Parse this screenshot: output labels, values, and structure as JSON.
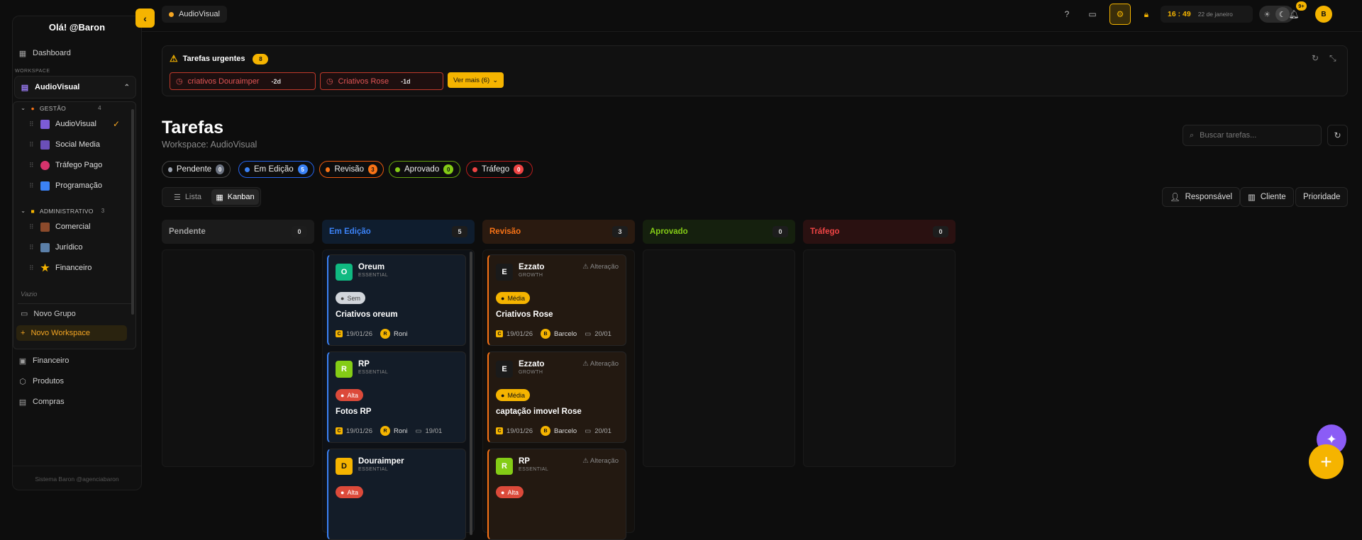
{
  "sidebar": {
    "greeting": "Olá! @Baron",
    "dashboard": "Dashboard",
    "workspace_label": "WORKSPACE",
    "workspace_current": "AudioVisual",
    "groups": [
      {
        "name": "GESTÃO",
        "count": "4",
        "items": [
          "AudioVisual",
          "Social Media",
          "Tráfego Pago",
          "Programação"
        ]
      },
      {
        "name": "ADMINISTRATIVO",
        "count": "3",
        "items": [
          "Comercial",
          "Jurídico",
          "Financeiro"
        ]
      }
    ],
    "empty": "Vazio",
    "new_group": "Novo Grupo",
    "new_workspace": "Novo Workspace",
    "bottom_links": [
      "Financeiro",
      "Produtos",
      "Compras"
    ],
    "footer": "Sistema Baron @agenciabaron"
  },
  "topbar": {
    "breadcrumb": "AudioVisual",
    "time": "16 : 49",
    "date": "22 de janeiro",
    "notif_badge": "9+",
    "avatar": "B"
  },
  "urgent": {
    "title": "Tarefas urgentes",
    "count": "8",
    "chips": [
      {
        "label": "criativos Douraimper",
        "delay": "-2d"
      },
      {
        "label": "Criativos Rose",
        "delay": "-1d"
      }
    ],
    "more": "Ver mais (6)"
  },
  "page": {
    "title": "Tarefas",
    "subtitle": "Workspace: AudioVisual",
    "search_placeholder": "Buscar tarefas..."
  },
  "statuses": [
    {
      "label": "Pendente",
      "count": "0",
      "color": "#9ca3af"
    },
    {
      "label": "Em Edição",
      "count": "5",
      "color": "#3b82f6"
    },
    {
      "label": "Revisão",
      "count": "3",
      "color": "#f97316"
    },
    {
      "label": "Aprovado",
      "count": "0",
      "color": "#84cc16"
    },
    {
      "label": "Tráfego",
      "count": "0",
      "color": "#ef4444"
    }
  ],
  "views": {
    "list": "Lista",
    "kanban": "Kanban"
  },
  "filters": {
    "responsible": "Responsável",
    "client": "Cliente",
    "priority": "Prioridade"
  },
  "columns": [
    {
      "label": "Pendente",
      "count": "0"
    },
    {
      "label": "Em Edição",
      "count": "5"
    },
    {
      "label": "Revisão",
      "count": "3"
    },
    {
      "label": "Aprovado",
      "count": "0"
    },
    {
      "label": "Tráfego",
      "count": "0"
    }
  ],
  "cards_edicao": [
    {
      "initial": "O",
      "client": "Oreum",
      "plan": "ESSENTIAL",
      "priority": "Sem",
      "title": "Criativos oreum",
      "created": "19/01/26",
      "user_initial": "R",
      "user": "Roni",
      "due": ""
    },
    {
      "initial": "R",
      "client": "RP",
      "plan": "ESSENTIAL",
      "priority": "Alta",
      "title": "Fotos RP",
      "created": "19/01/26",
      "user_initial": "R",
      "user": "Roni",
      "due": "19/01"
    },
    {
      "initial": "D",
      "client": "Douraimper",
      "plan": "ESSENTIAL",
      "priority": "Alta",
      "title": "",
      "created": "",
      "user_initial": "",
      "user": "",
      "due": ""
    }
  ],
  "cards_revisao": [
    {
      "initial": "E",
      "client": "Ezzato",
      "plan": "GROWTH",
      "tag": "Alteração",
      "priority": "Média",
      "title": "Criativos Rose",
      "created": "19/01/26",
      "user_initial": "B",
      "user": "Barcelo",
      "due": "20/01"
    },
    {
      "initial": "E",
      "client": "Ezzato",
      "plan": "GROWTH",
      "tag": "Alteração",
      "priority": "Média",
      "title": "captação imovel Rose",
      "created": "19/01/26",
      "user_initial": "B",
      "user": "Barcelo",
      "due": "20/01"
    },
    {
      "initial": "R",
      "client": "RP",
      "plan": "ESSENTIAL",
      "tag": "Alteração",
      "priority": "Alta",
      "title": "",
      "created": "",
      "user_initial": "",
      "user": "",
      "due": ""
    }
  ],
  "colors": {
    "accent": "#f5b400",
    "ai": "#8b5cf6"
  }
}
